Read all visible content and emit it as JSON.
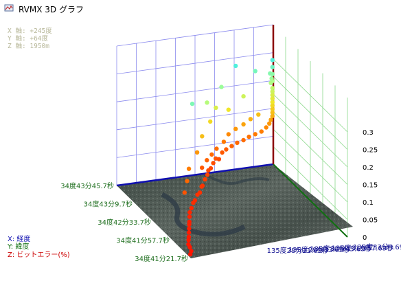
{
  "window": {
    "title": "RVMX 3D グラフ"
  },
  "readout": {
    "x": "X 軸: +245度",
    "y": "Y 軸: +64度",
    "z": "Z 軸: 1950m"
  },
  "legend": {
    "x": "X: 経度",
    "y": "Y: 緯度",
    "z": "Z: ビットエラー(%)"
  },
  "colors": {
    "x_axis": "#1010b0",
    "y_axis": "#107010",
    "z_axis": "#8b0000",
    "wall_grid": "#8a8aee",
    "floor_grid": "#8ad88a"
  },
  "chart_data": {
    "type": "scatter3d",
    "title": "",
    "xlabel": "経度",
    "ylabel": "緯度",
    "zlabel": "ビットエラー(%)",
    "z_range": [
      0,
      0.3
    ],
    "z_ticks": [
      "0.3",
      "0.25",
      "0.2",
      "0.15",
      "0.1",
      "0.05",
      "0"
    ],
    "y_ticks": [
      "34度43分45.7秒",
      "34度43分9.7秒",
      "34度42分33.7秒",
      "34度41分57.7秒",
      "34度41分21.7秒"
    ],
    "x_ticks": [
      "135度33分9.69秒",
      "135度31分57.69秒",
      "135度30分45.69秒",
      "135度29分33.69秒",
      "135度28分21.69秒"
    ],
    "grid": true,
    "floor": "aerial photo",
    "points": [
      {
        "x": 0.02,
        "y": 0.05,
        "z": 0.0
      },
      {
        "x": 0.04,
        "y": 0.08,
        "z": 0.002
      },
      {
        "x": 0.05,
        "y": 0.12,
        "z": 0.004
      },
      {
        "x": 0.06,
        "y": 0.16,
        "z": 0.003
      },
      {
        "x": 0.08,
        "y": 0.2,
        "z": 0.006
      },
      {
        "x": 0.1,
        "y": 0.24,
        "z": 0.005
      },
      {
        "x": 0.12,
        "y": 0.28,
        "z": 0.008
      },
      {
        "x": 0.14,
        "y": 0.32,
        "z": 0.01
      },
      {
        "x": 0.16,
        "y": 0.36,
        "z": 0.012
      },
      {
        "x": 0.18,
        "y": 0.4,
        "z": 0.01
      },
      {
        "x": 0.2,
        "y": 0.44,
        "z": 0.015
      },
      {
        "x": 0.22,
        "y": 0.48,
        "z": 0.018
      },
      {
        "x": 0.25,
        "y": 0.52,
        "z": 0.02
      },
      {
        "x": 0.28,
        "y": 0.56,
        "z": 0.025
      },
      {
        "x": 0.31,
        "y": 0.6,
        "z": 0.022
      },
      {
        "x": 0.34,
        "y": 0.63,
        "z": 0.03
      },
      {
        "x": 0.37,
        "y": 0.66,
        "z": 0.028
      },
      {
        "x": 0.4,
        "y": 0.7,
        "z": 0.035
      },
      {
        "x": 0.42,
        "y": 0.73,
        "z": 0.03
      },
      {
        "x": 0.45,
        "y": 0.76,
        "z": 0.04
      },
      {
        "x": 0.48,
        "y": 0.79,
        "z": 0.045
      },
      {
        "x": 0.5,
        "y": 0.82,
        "z": 0.05
      },
      {
        "x": 0.53,
        "y": 0.85,
        "z": 0.048
      },
      {
        "x": 0.56,
        "y": 0.88,
        "z": 0.055
      },
      {
        "x": 0.59,
        "y": 0.91,
        "z": 0.06
      },
      {
        "x": 0.62,
        "y": 0.93,
        "z": 0.052
      },
      {
        "x": 0.65,
        "y": 0.95,
        "z": 0.065
      },
      {
        "x": 0.68,
        "y": 0.96,
        "z": 0.07
      },
      {
        "x": 0.72,
        "y": 0.97,
        "z": 0.075
      },
      {
        "x": 0.76,
        "y": 0.98,
        "z": 0.08
      },
      {
        "x": 0.8,
        "y": 0.98,
        "z": 0.085
      },
      {
        "x": 0.84,
        "y": 0.99,
        "z": 0.09
      },
      {
        "x": 0.88,
        "y": 0.99,
        "z": 0.095
      },
      {
        "x": 0.92,
        "y": 0.99,
        "z": 0.1
      },
      {
        "x": 0.95,
        "y": 0.99,
        "z": 0.11
      },
      {
        "x": 0.97,
        "y": 0.99,
        "z": 0.12
      },
      {
        "x": 0.98,
        "y": 0.99,
        "z": 0.13
      },
      {
        "x": 0.99,
        "y": 0.99,
        "z": 0.14
      },
      {
        "x": 0.99,
        "y": 0.99,
        "z": 0.15
      },
      {
        "x": 0.99,
        "y": 0.99,
        "z": 0.16
      },
      {
        "x": 0.99,
        "y": 0.99,
        "z": 0.17
      },
      {
        "x": 0.99,
        "y": 0.99,
        "z": 0.18
      },
      {
        "x": 0.99,
        "y": 0.99,
        "z": 0.19
      },
      {
        "x": 0.99,
        "y": 0.99,
        "z": 0.2
      },
      {
        "x": 0.99,
        "y": 0.99,
        "z": 0.21
      },
      {
        "x": 0.99,
        "y": 0.99,
        "z": 0.22
      },
      {
        "x": 0.99,
        "y": 0.99,
        "z": 0.24
      },
      {
        "x": 0.99,
        "y": 0.99,
        "z": 0.26
      },
      {
        "x": 0.99,
        "y": 0.99,
        "z": 0.28
      },
      {
        "x": 0.99,
        "y": 0.99,
        "z": 0.3
      },
      {
        "x": 0.98,
        "y": 0.99,
        "z": 0.235
      },
      {
        "x": 0.98,
        "y": 0.98,
        "z": 0.25
      },
      {
        "x": 0.97,
        "y": 0.98,
        "z": 0.265
      },
      {
        "x": 0.66,
        "y": 0.95,
        "z": 0.095
      },
      {
        "x": 0.6,
        "y": 0.92,
        "z": 0.085
      },
      {
        "x": 0.55,
        "y": 0.88,
        "z": 0.08
      },
      {
        "x": 0.5,
        "y": 0.84,
        "z": 0.075
      },
      {
        "x": 0.45,
        "y": 0.8,
        "z": 0.065
      },
      {
        "x": 0.7,
        "y": 0.97,
        "z": 0.11
      },
      {
        "x": 0.75,
        "y": 0.98,
        "z": 0.12
      },
      {
        "x": 0.8,
        "y": 0.98,
        "z": 0.13
      },
      {
        "x": 0.85,
        "y": 0.99,
        "z": 0.14
      },
      {
        "x": 0.9,
        "y": 0.99,
        "z": 0.15
      },
      {
        "x": 0.4,
        "y": 0.76,
        "z": 0.12
      },
      {
        "x": 0.46,
        "y": 0.82,
        "z": 0.15
      },
      {
        "x": 0.55,
        "y": 0.9,
        "z": 0.17
      },
      {
        "x": 0.6,
        "y": 0.93,
        "z": 0.2
      },
      {
        "x": 0.52,
        "y": 0.88,
        "z": 0.23
      },
      {
        "x": 0.7,
        "y": 0.97,
        "z": 0.18
      },
      {
        "x": 0.8,
        "y": 0.98,
        "z": 0.21
      },
      {
        "x": 0.65,
        "y": 0.96,
        "z": 0.25
      },
      {
        "x": 0.35,
        "y": 0.72,
        "z": 0.27
      },
      {
        "x": 0.75,
        "y": 0.98,
        "z": 0.3
      },
      {
        "x": 0.88,
        "y": 0.99,
        "z": 0.275
      },
      {
        "x": 0.3,
        "y": 0.66,
        "z": 0.1
      },
      {
        "x": 0.26,
        "y": 0.6,
        "z": 0.08
      },
      {
        "x": 0.22,
        "y": 0.55,
        "z": 0.06
      }
    ]
  }
}
